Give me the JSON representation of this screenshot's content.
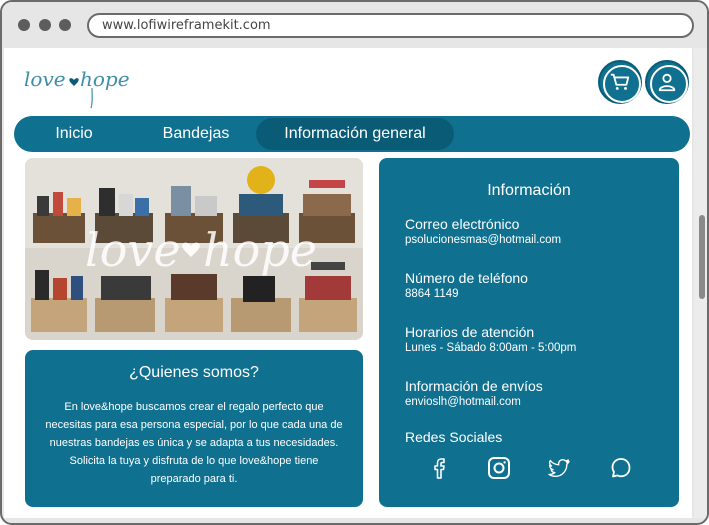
{
  "browser": {
    "url": "www.lofiwireframekit.com"
  },
  "header": {
    "logo_text": "love♥hope",
    "cart_icon": "cart-icon",
    "user_icon": "user-icon"
  },
  "nav": {
    "items": [
      {
        "label": "Inicio",
        "active": false
      },
      {
        "label": "Bandejas",
        "active": false
      },
      {
        "label": "Información general",
        "active": true
      }
    ]
  },
  "photo": {
    "overlay_text": "love♥hope"
  },
  "about": {
    "title": "¿Quienes somos?",
    "text": "En love&hope buscamos crear el regalo perfecto que necesitas para esa persona especial, por lo que cada una de nuestras bandejas es única y se adapta a tus necesidades. Solicita la tuya y disfruta de lo que love&hope tiene preparado para ti."
  },
  "info": {
    "title": "Información",
    "email_label": "Correo electrónico",
    "email_value": "psolucionesmas@hotmail.com",
    "phone_label": "Número de teléfono",
    "phone_value": "8864 1149",
    "hours_label": "Horarios de atención",
    "hours_value": "Lunes - Sábado 8:00am - 5:00pm",
    "shipping_label": "Información de envíos",
    "shipping_value": "envioslh@hotmail.com",
    "social_label": "Redes Sociales",
    "social_icons": [
      "facebook-icon",
      "instagram-icon",
      "twitter-icon",
      "whatsapp-icon"
    ]
  },
  "colors": {
    "primary": "#10708f",
    "primary_dark": "#0a5c76",
    "background": "#ffffff"
  }
}
